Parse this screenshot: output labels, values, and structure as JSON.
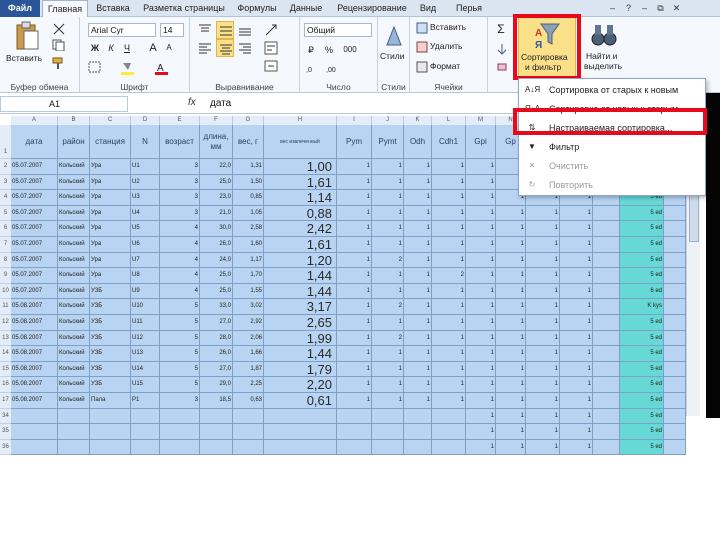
{
  "tabs": [
    "Файл",
    "Главная",
    "Вставка",
    "Разметка страницы",
    "Формулы",
    "Данные",
    "Рецензирование",
    "Вид",
    "Перья"
  ],
  "window_controls": [
    "–",
    "⧉",
    "✕",
    "?",
    "–",
    "⧉",
    "✕"
  ],
  "ribbon": {
    "clipboard": {
      "label": "Буфер обмена",
      "paste": "Вставить"
    },
    "font": {
      "label": "Шрифт",
      "name": "Arial Cyr",
      "size": "14",
      "bold": "Ж",
      "italic": "К",
      "underline": "Ч",
      "grow": "A",
      "shrink": "A"
    },
    "alignment": {
      "label": "Выравнивание"
    },
    "number": {
      "label": "Число",
      "format": "Общий",
      "percent": "%",
      "thousands": "000",
      "currency": "₽"
    },
    "styles": {
      "label": "Стили",
      "button": "Стили"
    },
    "cells": {
      "label": "Ячейки",
      "insert": "Вставить",
      "delete": "Удалить",
      "format": "Формат"
    },
    "editing": {
      "sum": "Σ",
      "sort": "Сортировка и фильтр",
      "sort_line1": "Сортировка",
      "sort_line2": "и фильтр",
      "find": "Найти и выделить",
      "find_line1": "Найти и",
      "find_line2": "выделить"
    }
  },
  "formula_bar": {
    "cell": "A1",
    "fx": "fx",
    "value": "дата"
  },
  "columns": [
    "A",
    "B",
    "C",
    "D",
    "E",
    "F",
    "G",
    "H",
    "I",
    "J",
    "K",
    "L",
    "M",
    "N",
    "O",
    "P",
    "Q",
    "R",
    "S",
    "T"
  ],
  "headers": [
    "дата",
    "район",
    "станция",
    "N",
    "возраст",
    "длина, мм",
    "вес, г",
    "вес извлеченный",
    "Pym",
    "Pymt",
    "Odh",
    "Cdh1",
    "Gpi",
    "Gp"
  ],
  "rows": [
    {
      "n": "2",
      "date": "05.07.2007",
      "district": "Кольский",
      "station": "Ура",
      "id": "U1",
      "age": "3",
      "len": "22,0",
      "w": "1,31",
      "big": "1,00",
      "p": [
        "1",
        "1",
        "1",
        "1"
      ]
    },
    {
      "n": "3",
      "date": "05.07.2007",
      "district": "Кольский",
      "station": "Ура",
      "id": "U2",
      "age": "3",
      "len": "25,0",
      "w": "1,50",
      "big": "1,61",
      "p": [
        "1",
        "1",
        "1",
        "1"
      ]
    },
    {
      "n": "4",
      "date": "05.07.2007",
      "district": "Кольский",
      "station": "Ура",
      "id": "U3",
      "age": "3",
      "len": "23,0",
      "w": "0,85",
      "big": "1,14",
      "p": [
        "1",
        "1",
        "1",
        "1"
      ]
    },
    {
      "n": "5",
      "date": "05.07.2007",
      "district": "Кольский",
      "station": "Ура",
      "id": "U4",
      "age": "3",
      "len": "21,0",
      "w": "1,05",
      "big": "0,88",
      "p": [
        "1",
        "1",
        "1",
        "1"
      ]
    },
    {
      "n": "6",
      "date": "05.07.2007",
      "district": "Кольский",
      "station": "Ура",
      "id": "U5",
      "age": "4",
      "len": "30,0",
      "w": "2,58",
      "big": "2,42",
      "p": [
        "1",
        "1",
        "1",
        "1"
      ]
    },
    {
      "n": "7",
      "date": "05.07.2007",
      "district": "Кольский",
      "station": "Ура",
      "id": "U6",
      "age": "4",
      "len": "26,0",
      "w": "1,60",
      "big": "1,61",
      "p": [
        "1",
        "1",
        "1",
        "1"
      ]
    },
    {
      "n": "8",
      "date": "05.07.2007",
      "district": "Кольский",
      "station": "Ура",
      "id": "U7",
      "age": "4",
      "len": "24,0",
      "w": "1,17",
      "big": "1,20",
      "p": [
        "1",
        "2",
        "1",
        "1"
      ]
    },
    {
      "n": "9",
      "date": "05.07.2007",
      "district": "Кольский",
      "station": "Ура",
      "id": "U8",
      "age": "4",
      "len": "25,0",
      "w": "1,70",
      "big": "1,44",
      "p": [
        "1",
        "1",
        "1",
        "2"
      ]
    },
    {
      "n": "10",
      "date": "05.07.2007",
      "district": "Кольский",
      "station": "УЗБ",
      "id": "U9",
      "age": "4",
      "len": "25,0",
      "w": "1,55",
      "big": "1,44",
      "p": [
        "1",
        "1",
        "1",
        "1"
      ]
    },
    {
      "n": "11",
      "date": "05.08.2007",
      "district": "Кольский",
      "station": "УЗБ",
      "id": "U10",
      "age": "5",
      "len": "33,0",
      "w": "3,02",
      "big": "3,17",
      "p": [
        "1",
        "2",
        "1",
        "1"
      ]
    },
    {
      "n": "12",
      "date": "05.08.2007",
      "district": "Кольский",
      "station": "УЗБ",
      "id": "U11",
      "age": "5",
      "len": "27,0",
      "w": "2,92",
      "big": "2,65",
      "p": [
        "1",
        "1",
        "1",
        "1"
      ]
    },
    {
      "n": "13",
      "date": "05.08.2007",
      "district": "Кольский",
      "station": "УЗБ",
      "id": "U12",
      "age": "5",
      "len": "28,0",
      "w": "2,06",
      "big": "1,99",
      "p": [
        "1",
        "2",
        "1",
        "1"
      ]
    },
    {
      "n": "14",
      "date": "05.08.2007",
      "district": "Кольский",
      "station": "УЗБ",
      "id": "U13",
      "age": "5",
      "len": "26,0",
      "w": "1,66",
      "big": "1,44",
      "p": [
        "1",
        "1",
        "1",
        "1"
      ]
    },
    {
      "n": "15",
      "date": "05.08.2007",
      "district": "Кольский",
      "station": "УЗБ",
      "id": "U14",
      "age": "5",
      "len": "27,0",
      "w": "1,87",
      "big": "1,79",
      "p": [
        "1",
        "1",
        "1",
        "1"
      ]
    },
    {
      "n": "16",
      "date": "05.08.2007",
      "district": "Кольский",
      "station": "УЗБ",
      "id": "U15",
      "age": "5",
      "len": "29,0",
      "w": "2,25",
      "big": "2,20",
      "p": [
        "1",
        "1",
        "1",
        "1"
      ]
    },
    {
      "n": "17",
      "date": "05.08.2007",
      "district": "Кольский",
      "station": "Пала",
      "id": "P1",
      "age": "3",
      "len": "18,5",
      "w": "0,63",
      "big": "0,61",
      "p": [
        "1",
        "1",
        "1",
        "1"
      ]
    }
  ],
  "teal_values": [
    "5 ed",
    "5 ed",
    "5 ed",
    "5 ed",
    "5 ed",
    "5 ed",
    "5 ed",
    "5 ed",
    "6 ed",
    "K kys",
    "5 ed",
    "5 ed",
    "5 ed",
    "5 ed",
    "5 ed",
    "5 ed",
    "5 ed",
    "5 ed",
    "5 ed"
  ],
  "menu": [
    {
      "icon": "А↓Я",
      "label": "Сортировка от старых к новым",
      "disabled": false
    },
    {
      "icon": "Я↓А",
      "label": "Сортировка от новых к старым",
      "disabled": false
    },
    {
      "icon": "⇅",
      "label": "Настраиваемая сортировка...",
      "disabled": false
    },
    {
      "icon": "▼",
      "label": "Фильтр",
      "disabled": false
    },
    {
      "icon": "✕",
      "label": "Очистить",
      "disabled": true
    },
    {
      "icon": "↻",
      "label": "Повторить",
      "disabled": true
    }
  ],
  "colors": {
    "accent": "#2a5699",
    "selection": "#b8d4f2",
    "teal": "#66d9d6",
    "highlight_red": "#e8091b"
  }
}
